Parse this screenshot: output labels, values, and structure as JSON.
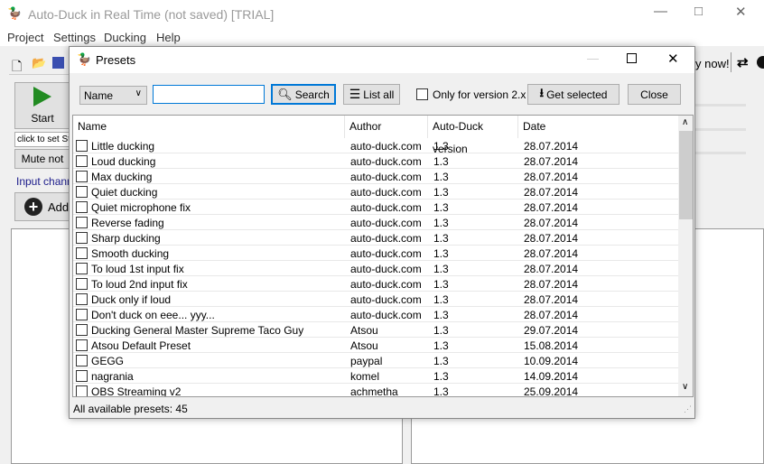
{
  "main": {
    "title": "Auto-Duck in Real Time (not saved) [TRIAL]",
    "menu": [
      "Project",
      "Settings",
      "Ducking",
      "Help"
    ],
    "start_label": "Start",
    "start_time_field": "click to set St",
    "mute_label": "Mute not",
    "input_channels_label": "Input chann",
    "add_label": "Add",
    "buy_now": "y now!"
  },
  "dialog": {
    "title": "Presets",
    "search_by": "Name",
    "search_value": "",
    "search_label": "Search",
    "list_all_label": "List all",
    "only_v2_label": "Only for version 2.x",
    "get_selected_label": "Get selected",
    "close_label": "Close",
    "columns": [
      "Name",
      "Author",
      "Auto-Duck version",
      "Date"
    ],
    "rows": [
      [
        "Little ducking",
        "auto-duck.com",
        "1.3",
        "28.07.2014"
      ],
      [
        "Loud ducking",
        "auto-duck.com",
        "1.3",
        "28.07.2014"
      ],
      [
        "Max ducking",
        "auto-duck.com",
        "1.3",
        "28.07.2014"
      ],
      [
        "Quiet ducking",
        "auto-duck.com",
        "1.3",
        "28.07.2014"
      ],
      [
        "Quiet microphone fix",
        "auto-duck.com",
        "1.3",
        "28.07.2014"
      ],
      [
        "Reverse fading",
        "auto-duck.com",
        "1.3",
        "28.07.2014"
      ],
      [
        "Sharp ducking",
        "auto-duck.com",
        "1.3",
        "28.07.2014"
      ],
      [
        "Smooth ducking",
        "auto-duck.com",
        "1.3",
        "28.07.2014"
      ],
      [
        "To loud 1st input fix",
        "auto-duck.com",
        "1.3",
        "28.07.2014"
      ],
      [
        "To loud 2nd input fix",
        "auto-duck.com",
        "1.3",
        "28.07.2014"
      ],
      [
        "Duck only if loud",
        "auto-duck.com",
        "1.3",
        "28.07.2014"
      ],
      [
        "Don't duck on eee... yyy...",
        "auto-duck.com",
        "1.3",
        "28.07.2014"
      ],
      [
        "Ducking General Master Supreme Taco Guy",
        "Atsou",
        "1.3",
        "29.07.2014"
      ],
      [
        "Atsou Default Preset",
        "Atsou",
        "1.3",
        "15.08.2014"
      ],
      [
        "GEGG",
        "paypal",
        "1.3",
        "10.09.2014"
      ],
      [
        "nagrania",
        "komel",
        "1.3",
        "14.09.2014"
      ],
      [
        "OBS Streaming v2",
        "achmetha",
        "1.3",
        "25.09.2014"
      ]
    ],
    "status": "All available presets: 45"
  }
}
